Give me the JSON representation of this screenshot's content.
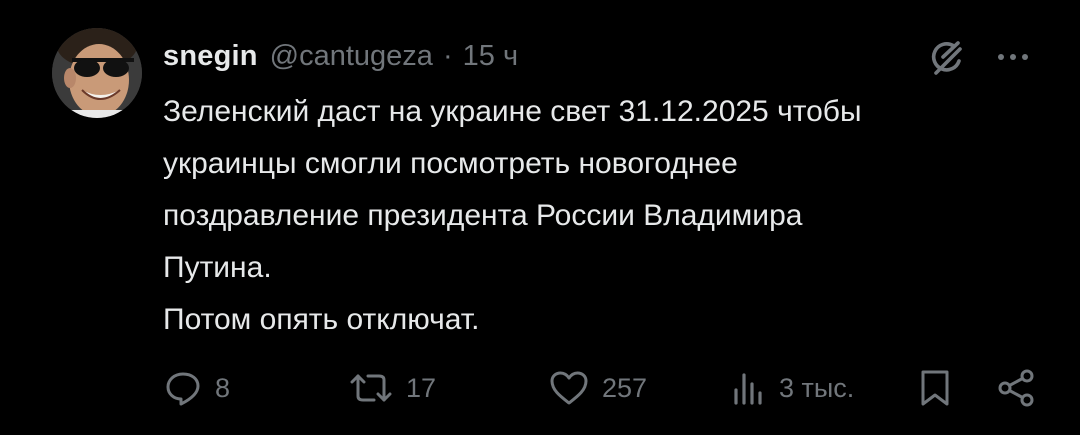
{
  "user": {
    "display_name": "snegin",
    "handle": "@cantugeza",
    "separator": "·",
    "time": "15 ч"
  },
  "tweet": {
    "lines": [
      "Зеленский даст на украине свет 31.12.2025 чтобы",
      "украинцы смогли посмотреть новогоднее",
      "поздравление президента России Владимира",
      "Путина.",
      "Потом опять отключат."
    ]
  },
  "actions": {
    "replies": "8",
    "reposts": "17",
    "likes": "257",
    "views": "3 тыс."
  },
  "icons": {
    "header": [
      "grok-icon",
      "more-icon"
    ],
    "actions": [
      "reply-icon",
      "repost-icon",
      "like-icon",
      "views-icon",
      "bookmark-icon",
      "share-icon"
    ]
  },
  "colors": {
    "background": "#000000",
    "text": "#e7e9ea",
    "secondary": "#71767b"
  }
}
